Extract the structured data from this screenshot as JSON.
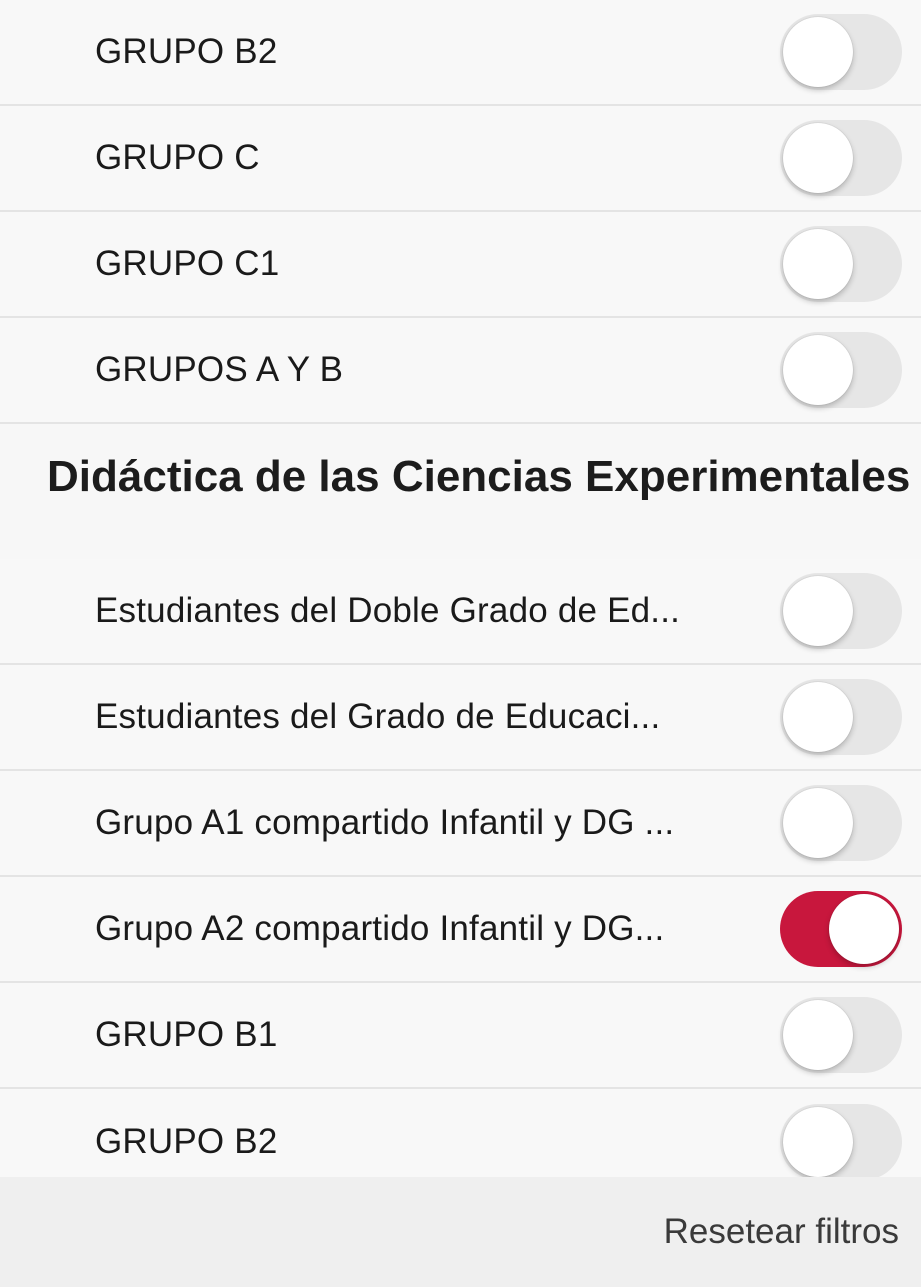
{
  "colors": {
    "accent": "#c8173d",
    "toggle_off": "#e6e6e6",
    "background": "#f7f7f7"
  },
  "top_rows": [
    {
      "label": "GRUPO B2",
      "on": false
    },
    {
      "label": "GRUPO C",
      "on": false
    },
    {
      "label": "GRUPO C1",
      "on": false
    },
    {
      "label": "GRUPOS A Y B",
      "on": false
    }
  ],
  "section": {
    "title": "Didáctica de las Ciencias Experimentales",
    "rows": [
      {
        "label": "Estudiantes del Doble Grado de Ed...",
        "on": false
      },
      {
        "label": "Estudiantes del Grado de Educaci...",
        "on": false
      },
      {
        "label": "Grupo A1 compartido Infantil y DG ...",
        "on": false
      },
      {
        "label": "Grupo A2 compartido Infantil y DG...",
        "on": true
      },
      {
        "label": "GRUPO B1",
        "on": false
      },
      {
        "label": "GRUPO B2",
        "on": false
      }
    ]
  },
  "footer": {
    "reset_label": "Resetear filtros"
  }
}
